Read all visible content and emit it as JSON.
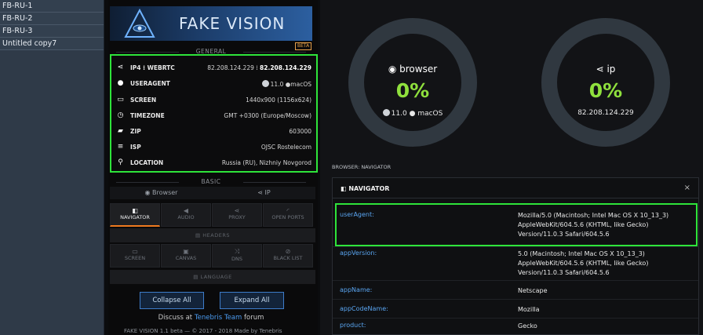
{
  "profiles": [
    "FB-RU-1",
    "FB-RU-2",
    "FB-RU-3",
    "Untitled copy7"
  ],
  "logo": {
    "brand": "FAKE VISION",
    "beta": "BETA"
  },
  "general": {
    "title": "GENERAL",
    "rows": [
      {
        "icon": "share-icon",
        "label": "IP4 ⁞ WEBRTC",
        "value": "82.208.124.229",
        "value2": "82.208.124.229"
      },
      {
        "icon": "user-icon",
        "label": "USERAGENT",
        "value": "11.0",
        "value2": "macOS"
      },
      {
        "icon": "screen-icon",
        "label": "SCREEN",
        "value": "1440x900 (1156x624)"
      },
      {
        "icon": "clock-icon",
        "label": "TIMEZONE",
        "value": "GMT +0300 (Europe/Moscow)"
      },
      {
        "icon": "truck-icon",
        "label": "ZIP",
        "value": "603000"
      },
      {
        "icon": "list-icon",
        "label": "ISP",
        "value": "OJSC Rostelecom"
      },
      {
        "icon": "pin-icon",
        "label": "LOCATION",
        "value": "Russia (RU), Nizhniy Novgorod"
      }
    ]
  },
  "basic": {
    "title": "BASIC",
    "tabs": [
      "Browser",
      "IP"
    ]
  },
  "grid": {
    "row1": [
      "NAVIGATOR",
      "AUDIO",
      "PROXY",
      "OPEN PORTS"
    ],
    "headers_label": "HEADERS",
    "row2": [
      "SCREEN",
      "CANVAS",
      "DNS",
      "BLACK LIST"
    ],
    "language_label": "LANGUAGE"
  },
  "buttons": {
    "collapse": "Collapse All",
    "expand": "Expand All"
  },
  "discuss": {
    "prefix": "Discuss at",
    "link": "Tenebris Team",
    "suffix": "forum"
  },
  "footer": "FAKE VISION 1.1 beta — © 2017 - 2018 Made by Tenebris",
  "rings": {
    "browser": {
      "title": "browser",
      "percent": "0%",
      "version": "11.0",
      "os": "macOS"
    },
    "ip": {
      "title": "ip",
      "percent": "0%",
      "address": "82.208.124.229"
    }
  },
  "navigator": {
    "section_label": "BROWSER: NAVIGATOR",
    "title": "NAVIGATOR",
    "close": "×",
    "props": [
      {
        "key": "userAgent:",
        "lines": [
          "Mozilla/5.0 (Macintosh; Intel Mac OS X 10_13_3)",
          "AppleWebKit/604.5.6 (KHTML, like Gecko)",
          "Version/11.0.3 Safari/604.5.6"
        ]
      },
      {
        "key": "appVersion:",
        "lines": [
          "5.0 (Macintosh; Intel Mac OS X 10_13_3)",
          "AppleWebKit/604.5.6 (KHTML, like Gecko)",
          "Version/11.0.3 Safari/604.5.6"
        ]
      },
      {
        "key": "appName:",
        "lines": [
          "Netscape"
        ]
      },
      {
        "key": "appCodeName:",
        "lines": [
          "Mozilla"
        ]
      },
      {
        "key": "product:",
        "lines": [
          "Gecko"
        ]
      }
    ]
  },
  "colors": {
    "accent_green": "#2ee43a",
    "percent_green": "#8fe03d",
    "link_blue": "#5aa6f2",
    "tab_orange": "#ef7a1f"
  }
}
